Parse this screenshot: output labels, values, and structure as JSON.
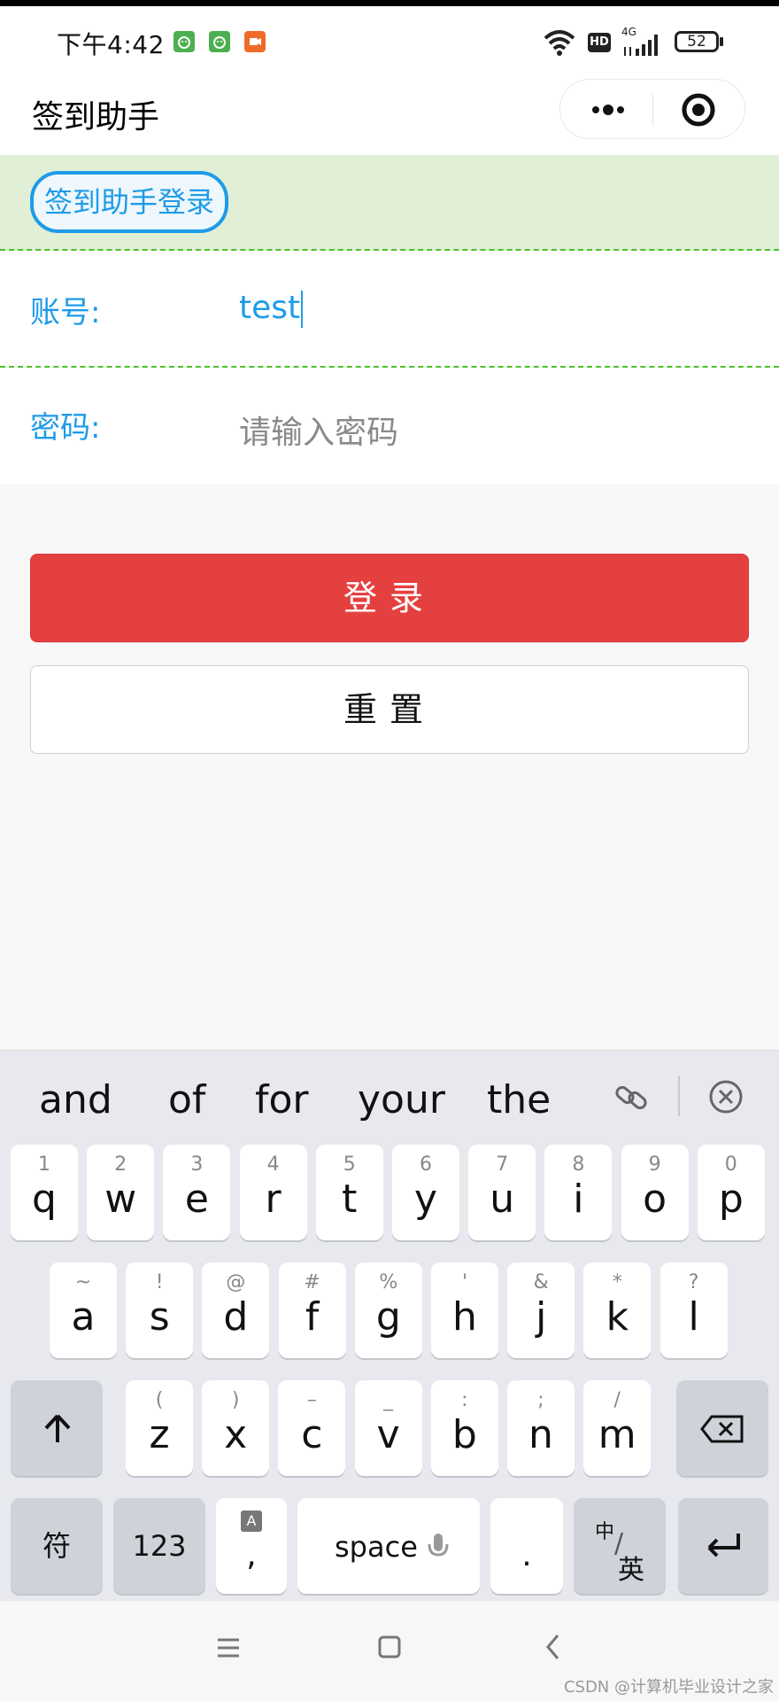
{
  "status_bar": {
    "time": "下午4:42",
    "network": "4G",
    "battery": "52",
    "icons": [
      "notification-android-icon",
      "notification-android-icon",
      "notification-video-icon",
      "wifi-icon",
      "hd-icon",
      "signal-icon",
      "battery-icon"
    ]
  },
  "navbar": {
    "title": "签到助手",
    "more_icon": "more-dots-icon",
    "close_icon": "target-close-icon"
  },
  "login_header": {
    "label": "签到助手登录"
  },
  "form": {
    "account_label": "账号:",
    "account_value": "test",
    "password_label": "密码:",
    "password_placeholder": "请输入密码"
  },
  "buttons": {
    "login": "登录",
    "reset": "重置"
  },
  "keyboard": {
    "suggestions": [
      "and",
      "of",
      "for",
      "your",
      "the"
    ],
    "row1": [
      {
        "hint": "1",
        "ch": "q"
      },
      {
        "hint": "2",
        "ch": "w"
      },
      {
        "hint": "3",
        "ch": "e"
      },
      {
        "hint": "4",
        "ch": "r"
      },
      {
        "hint": "5",
        "ch": "t"
      },
      {
        "hint": "6",
        "ch": "y"
      },
      {
        "hint": "7",
        "ch": "u"
      },
      {
        "hint": "8",
        "ch": "i"
      },
      {
        "hint": "9",
        "ch": "o"
      },
      {
        "hint": "0",
        "ch": "p"
      }
    ],
    "row2": [
      {
        "hint": "~",
        "ch": "a"
      },
      {
        "hint": "!",
        "ch": "s"
      },
      {
        "hint": "@",
        "ch": "d"
      },
      {
        "hint": "#",
        "ch": "f"
      },
      {
        "hint": "%",
        "ch": "g"
      },
      {
        "hint": "'",
        "ch": "h"
      },
      {
        "hint": "&",
        "ch": "j"
      },
      {
        "hint": "*",
        "ch": "k"
      },
      {
        "hint": "?",
        "ch": "l"
      }
    ],
    "row3": [
      {
        "hint": "(",
        "ch": "z"
      },
      {
        "hint": ")",
        "ch": "x"
      },
      {
        "hint": "–",
        "ch": "c"
      },
      {
        "hint": "_",
        "ch": "v"
      },
      {
        "hint": ":",
        "ch": "b"
      },
      {
        "hint": ";",
        "ch": "n"
      },
      {
        "hint": "/",
        "ch": "m"
      }
    ],
    "symbol_key": "符",
    "num_key": "123",
    "comma_key": ",",
    "space_key": "space",
    "period_key": ".",
    "lang_key_top": "中",
    "lang_key_bottom": "英"
  },
  "watermark": "CSDN @计算机毕业设计之家"
}
